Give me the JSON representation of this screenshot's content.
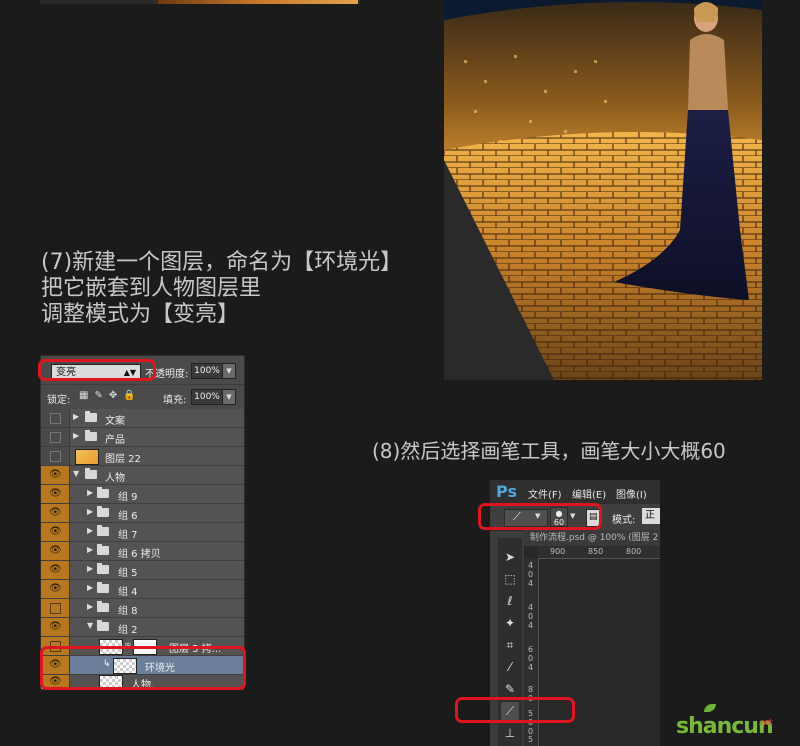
{
  "step7": {
    "lines": [
      "(7)新建一个图层，命名为【环境光】",
      "把它嵌套到人物图层里",
      "调整模式为【变亮】"
    ]
  },
  "step8": {
    "text": "(8)然后选择画笔工具，画笔大小大概60"
  },
  "layers_panel": {
    "blend_mode": "变亮",
    "opacity_label": "不透明度:",
    "opacity_value": "100%",
    "lock_label": "锁定:",
    "fill_label": "填充:",
    "fill_value": "100%",
    "layers": [
      {
        "name": "文案",
        "type": "folder",
        "visible": false
      },
      {
        "name": "产品",
        "type": "folder",
        "visible": false
      },
      {
        "name": "图层 22",
        "type": "layer",
        "visible": false
      },
      {
        "name": "人物",
        "type": "folder-open",
        "visible": true
      },
      {
        "name": "组 9",
        "type": "folder",
        "visible": true
      },
      {
        "name": "组 6",
        "type": "folder",
        "visible": true
      },
      {
        "name": "组 7",
        "type": "folder",
        "visible": true
      },
      {
        "name": "组 6 拷贝",
        "type": "folder",
        "visible": true
      },
      {
        "name": "组 5",
        "type": "folder",
        "visible": true
      },
      {
        "name": "组 4",
        "type": "folder",
        "visible": true
      },
      {
        "name": "组 8",
        "type": "folder",
        "visible": false
      },
      {
        "name": "组 2",
        "type": "folder-open",
        "visible": true
      },
      {
        "name": "图层 5 拷...",
        "type": "layer-mask",
        "visible": false
      },
      {
        "name": "环境光",
        "type": "layer-clipped",
        "visible": true,
        "selected": true
      },
      {
        "name": "人物.",
        "type": "smart",
        "visible": true
      }
    ]
  },
  "photoshop": {
    "logo": "Ps",
    "menu": [
      "文件(F)",
      "编辑(E)",
      "图像(I)"
    ],
    "brush_size": "60",
    "mode_label": "模式:",
    "mode_value": "正",
    "doc_tab": "制作流程.psd @ 100% (图层 2",
    "ruler_h": [
      "900",
      "850",
      "800"
    ],
    "ruler_v": [
      "4",
      "0",
      "4",
      "4",
      "0",
      "4",
      "6",
      "0",
      "4",
      "8",
      "0",
      "5",
      "0",
      "0",
      "5",
      "0"
    ],
    "tools": [
      "move-icon",
      "marquee-icon",
      "lasso-icon",
      "magic-wand-icon",
      "crop-icon",
      "eyedropper-icon",
      "healing-icon",
      "brush-icon",
      "stamp-icon"
    ]
  },
  "watermark": {
    "text": "shancun",
    "suffix": ".net"
  },
  "colors": {
    "background": "#1b1b1b",
    "highlight_ring": "#e0141e",
    "eye_column": "#b77820",
    "selected_layer": "#6c7f9a"
  }
}
